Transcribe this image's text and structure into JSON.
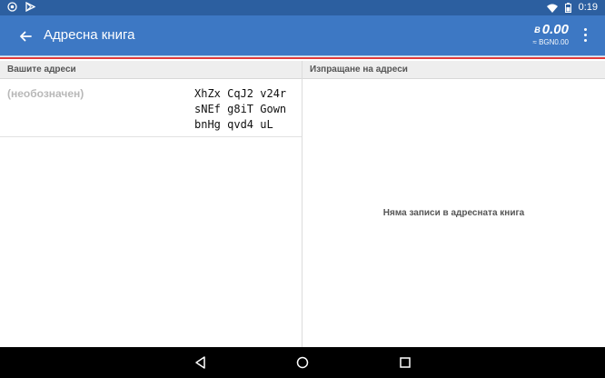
{
  "status_bar": {
    "time": "0:19",
    "left_icons": [
      "camera-icon",
      "play-store-icon"
    ],
    "right_icons": [
      "wifi-icon",
      "battery-icon"
    ]
  },
  "app_bar": {
    "title": "Адресна книга",
    "balance": {
      "amount": "0.00",
      "currency_symbol": "Ƀ",
      "fiat": "≈ BGN0.00"
    }
  },
  "left_panel": {
    "header": "Вашите адреси",
    "addresses": [
      {
        "label": "(необозначен)",
        "address": "XhZx CqJ2 v24r\nsNEf g8iT Gown\nbnHg qvd4 uL"
      }
    ]
  },
  "right_panel": {
    "header": "Изпращане на адреси",
    "empty_message": "Няма записи в адресната книга"
  },
  "nav_bar": {
    "buttons": [
      "back-triangle-icon",
      "home-circle-icon",
      "recents-square-icon"
    ]
  },
  "colors": {
    "status_bar": "#2c5fa0",
    "app_bar": "#3d78c4",
    "accent_line": "#e03a3a",
    "nav_bar": "#000000"
  }
}
